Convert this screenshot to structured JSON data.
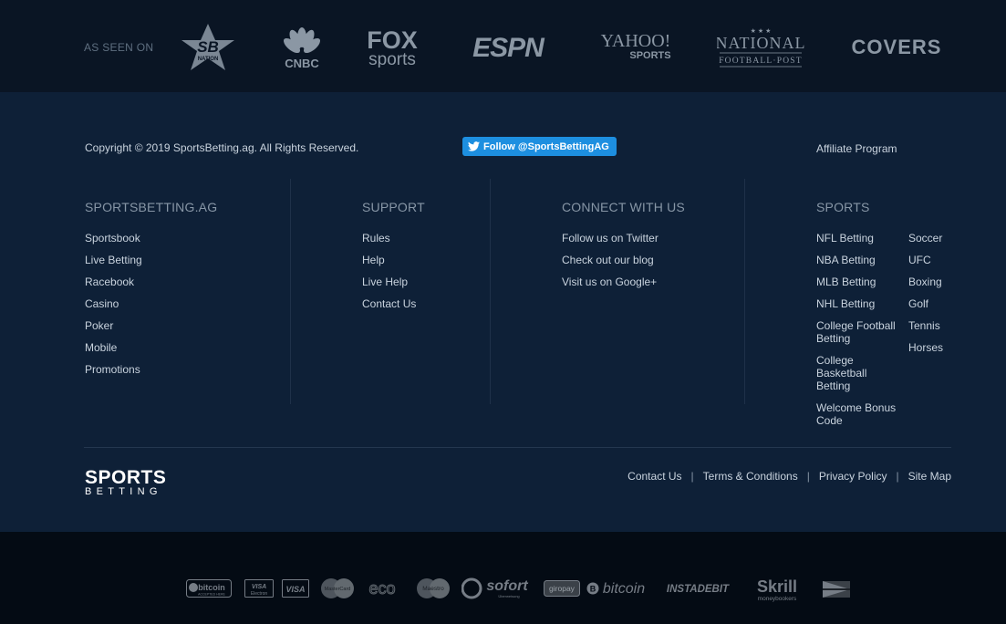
{
  "seen_on": {
    "label": "AS SEEN ON",
    "logos": {
      "sbnation": {
        "text": "SB",
        "sub": "NATION"
      },
      "cnbc": {
        "text": "CNBC"
      },
      "fox": {
        "text1": "FOX",
        "text2": "sports"
      },
      "espn": {
        "text": "ESPN"
      },
      "yahoo": {
        "text1": "YAHOO!",
        "text2": "SPORTS"
      },
      "nfp": {
        "text1": "NATIONAL",
        "text2": "FOOTBALL·POST"
      },
      "covers": {
        "text": "COVERS"
      }
    }
  },
  "footer": {
    "copyright": "Copyright © 2019 SportsBetting.ag. All Rights Reserved.",
    "twitter_button": "Follow @SportsBettingAG",
    "affiliate": "Affiliate Program",
    "columns": {
      "sportsbetting": {
        "title": "SPORTSBETTING.AG",
        "items": [
          "Sportsbook",
          "Live Betting",
          "Racebook",
          "Casino",
          "Poker",
          "Mobile",
          "Promotions"
        ]
      },
      "support": {
        "title": "SUPPORT",
        "items": [
          "Rules",
          "Help",
          "Live Help",
          "Contact Us"
        ]
      },
      "connect": {
        "title": "CONNECT WITH US",
        "items": [
          "Follow us on Twitter",
          "Check out our blog",
          "Visit us on Google+"
        ]
      },
      "sports": {
        "title": "SPORTS",
        "items_a": [
          "NFL Betting",
          "NBA Betting",
          "MLB Betting",
          "NHL Betting",
          "College Football Betting",
          "College Basketball Betting",
          "Welcome Bonus Code"
        ],
        "items_b": [
          "Soccer",
          "UFC",
          "Boxing",
          "Golf",
          "Tennis",
          "Horses"
        ]
      }
    },
    "brand": {
      "line1": "SPORTS",
      "line2": "BETTING"
    },
    "bottom_links": [
      "Contact Us",
      "Terms & Conditions",
      "Privacy Policy",
      "Site Map"
    ],
    "bottom_sep": "|"
  },
  "payments": {
    "bitcoin_accepted": {
      "text": "bitcoin",
      "sub": "ACCEPTED HERE"
    },
    "visa_electron": {
      "text": "VISA",
      "sub": "Electron"
    },
    "visa": {
      "text": "VISA"
    },
    "mastercard": {
      "text": "MasterCard"
    },
    "eco": {
      "text": "eco"
    },
    "maestro": {
      "text": "Maestro"
    },
    "sofort": {
      "text": "sofort",
      "sub": "Überweisung"
    },
    "giropay": {
      "text": "giropay"
    },
    "bitcoin": {
      "text": "bitcoin"
    },
    "instadebit": {
      "text": "INSTADEBIT"
    },
    "skrill": {
      "text": "Skrill",
      "sub": "moneybookers"
    }
  },
  "colors": {
    "twitter_blue": "#1d8fe0",
    "main_bg": "#0e2037",
    "top_bg": "#0a1524",
    "bottom_bg": "#040b14"
  }
}
